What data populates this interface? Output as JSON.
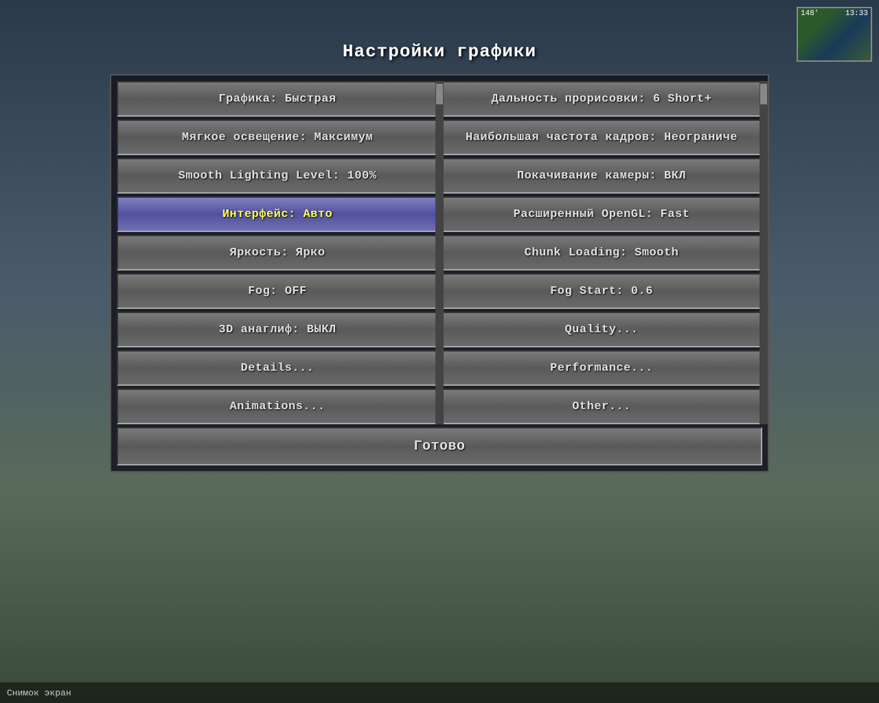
{
  "title": "Настройки графики",
  "minimap": {
    "distance_label": "148'",
    "time_label": "13:33"
  },
  "left_column": [
    {
      "id": "graphics",
      "label": "Графика: Быстрая",
      "highlighted": false
    },
    {
      "id": "soft-lighting",
      "label": "Мягкое освещение: Максимум",
      "highlighted": false
    },
    {
      "id": "smooth-lighting-level",
      "label": "Smooth Lighting Level: 100%",
      "highlighted": false
    },
    {
      "id": "interface",
      "label": "Интерфейс: Авто",
      "highlighted": true
    },
    {
      "id": "brightness",
      "label": "Яркость: Ярко",
      "highlighted": false
    },
    {
      "id": "fog",
      "label": "Fog: OFF",
      "highlighted": false
    },
    {
      "id": "3d-anaglyph",
      "label": "3D анаглиф: ВЫКЛ",
      "highlighted": false
    },
    {
      "id": "details",
      "label": "Details...",
      "highlighted": false
    },
    {
      "id": "animations",
      "label": "Animations...",
      "highlighted": false
    }
  ],
  "right_column": [
    {
      "id": "render-distance",
      "label": "Дальность прорисовки: 6 Short+",
      "highlighted": false
    },
    {
      "id": "max-framerate",
      "label": "Наибольшая частота кадров: Неограниче",
      "highlighted": false
    },
    {
      "id": "camera-sway",
      "label": "Покачивание камеры: ВКЛ",
      "highlighted": false
    },
    {
      "id": "advanced-opengl",
      "label": "Расширенный OpenGL: Fast",
      "highlighted": false
    },
    {
      "id": "chunk-loading",
      "label": "Chunk Loading: Smooth",
      "highlighted": false
    },
    {
      "id": "fog-start",
      "label": "Fog Start: 0.6",
      "highlighted": false
    },
    {
      "id": "quality",
      "label": "Quality...",
      "highlighted": false
    },
    {
      "id": "performance",
      "label": "Performance...",
      "highlighted": false
    },
    {
      "id": "other",
      "label": "Other...",
      "highlighted": false
    }
  ],
  "done_button": {
    "label": "Готово"
  },
  "bottom": {
    "screenshot_text": "Снимок экран"
  }
}
